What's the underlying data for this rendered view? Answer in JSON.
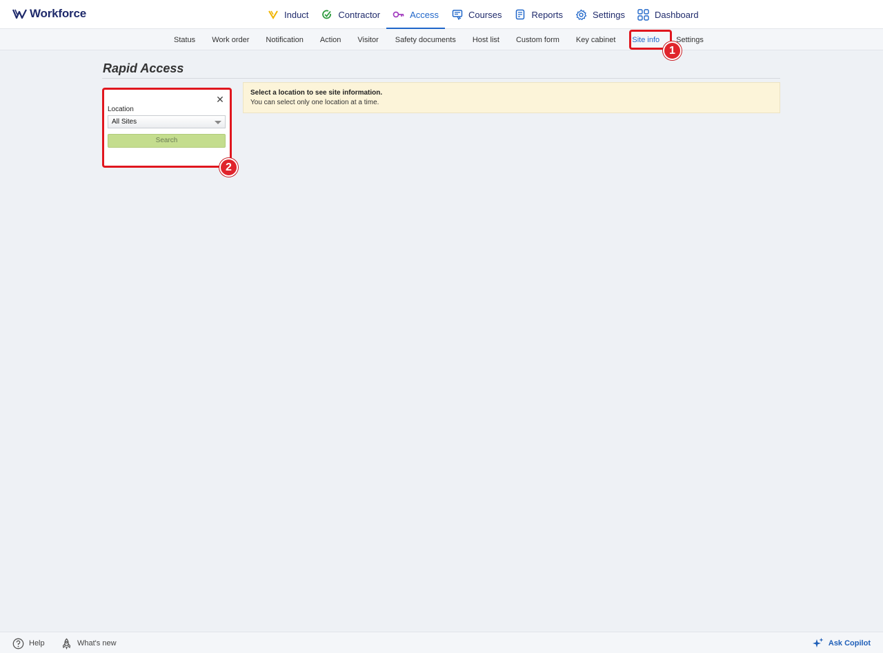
{
  "brand": {
    "name": "Workforce"
  },
  "main_nav": [
    {
      "label": "Induct",
      "icon": "induct-icon"
    },
    {
      "label": "Contractor",
      "icon": "contractor-check-icon"
    },
    {
      "label": "Access",
      "icon": "key-icon",
      "active": true
    },
    {
      "label": "Courses",
      "icon": "courses-icon"
    },
    {
      "label": "Reports",
      "icon": "reports-icon"
    },
    {
      "label": "Settings",
      "icon": "gear-icon"
    },
    {
      "label": "Dashboard",
      "icon": "dashboard-grid-icon"
    }
  ],
  "sub_nav": [
    {
      "label": "Status"
    },
    {
      "label": "Work order"
    },
    {
      "label": "Notification"
    },
    {
      "label": "Action"
    },
    {
      "label": "Visitor"
    },
    {
      "label": "Safety documents"
    },
    {
      "label": "Host list"
    },
    {
      "label": "Custom form"
    },
    {
      "label": "Key cabinet"
    },
    {
      "label": "Site info",
      "active": true
    },
    {
      "label": "Settings"
    }
  ],
  "page": {
    "title": "Rapid Access"
  },
  "filter": {
    "close_symbol": "✕",
    "location_label": "Location",
    "location_value": "All Sites",
    "search_label": "Search"
  },
  "info": {
    "heading": "Select a location to see site information.",
    "subtext": "You can select only one location at a time."
  },
  "annotations": [
    {
      "number": "1"
    },
    {
      "number": "2"
    }
  ],
  "footer": {
    "help": "Help",
    "whats_new": "What's new",
    "copilot": "Ask Copilot"
  },
  "colors": {
    "accent": "#1f66c9",
    "brand": "#1f2a6b",
    "highlight": "#e0161e",
    "search_button": "#c4dd8e",
    "info_background": "#fcf4d9"
  }
}
